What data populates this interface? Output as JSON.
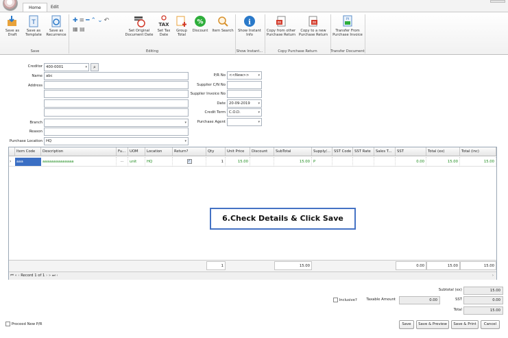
{
  "tabs": [
    {
      "label": "Home"
    },
    {
      "label": "Edit"
    }
  ],
  "ribbon": {
    "save_as_draft": "Save as Draft",
    "save_as_template": "Save as Template",
    "save_as_recurrence": "Save as Recurrence",
    "group_save": "Save",
    "set_original_document_date": "Set Original Document Date",
    "set_tax_date": "Set Tax Date",
    "group_total": "Group Total",
    "discount": "Discount",
    "item_search": "Item Search",
    "group_editing": "Editing",
    "show_instant_info": "Show Instant Info",
    "group_show_instant": "Show Instant...",
    "copy_from_other_purchase_return": "Copy from other Purchase Return",
    "copy_to_new_purchase_return": "Copy to a new Purchase Return",
    "group_copy_purchase_return": "Copy Purchase Return",
    "transfer_from_purchase_invoice": "Transfer From Purchase Invoice",
    "group_transfer_document": "Transfer Document"
  },
  "form": {
    "creditor_label": "Creditor",
    "creditor_value": "400-0001",
    "name_label": "Name",
    "name_value": "abc",
    "address_label": "Address",
    "branch_label": "Branch",
    "reason_label": "Reason",
    "purchase_location_label": "Purchase Location",
    "purchase_location_value": "HQ",
    "pr_no_label": "P/R No",
    "pr_no_value": "<<New>>",
    "supplier_cn_label": "Supplier C/N No",
    "supplier_invoice_label": "Supplier Invoice No",
    "date_label": "Date",
    "date_value": "20-09-2019",
    "credit_term_label": "Credit Term",
    "credit_term_value": "C.O.D.",
    "purchase_agent_label": "Purchase Agent"
  },
  "grid": {
    "columns": [
      "Item Code",
      "Description",
      "Fu...",
      "UOM",
      "Location",
      "Return?",
      "Qty",
      "Unit Price",
      "Discount",
      "SubTotal",
      "Supply/...",
      "SST Code",
      "SST Rate",
      "Sales T...",
      "SST",
      "Total (ex)",
      "Total (inc)"
    ],
    "row": {
      "item_code": "aaa",
      "description": "aaaaaaaaaaaaaa",
      "fu": "···",
      "uom": "unit",
      "location": "HQ",
      "qty": "1",
      "unit_price": "15.00",
      "subtotal": "15.00",
      "supply": "P",
      "sst": "0.00",
      "total_ex": "15.00",
      "total_inc": "15.00"
    },
    "footer": {
      "qty": "1",
      "subtotal": "15.00",
      "sst": "0.00",
      "total_ex": "15.00",
      "total_inc": "15.00"
    },
    "navigator": "Record 1 of 1"
  },
  "callout": "6.Check Details & Click Save",
  "totals": {
    "subtotal_ex_label": "Subtotal (ex)",
    "subtotal_ex_value": "15.00",
    "sst_label": "SST",
    "sst_value": "0.00",
    "total_label": "Total",
    "total_value": "15.00",
    "inclusive_label": "Inclusive?",
    "taxable_amount_label": "Taxable Amount",
    "taxable_amount_value": "0.00"
  },
  "bottom": {
    "proceed_new_label": "Proceed New P/R",
    "save": "Save",
    "save_preview": "Save & Preview",
    "save_print": "Save & Print",
    "cancel": "Cancel"
  }
}
